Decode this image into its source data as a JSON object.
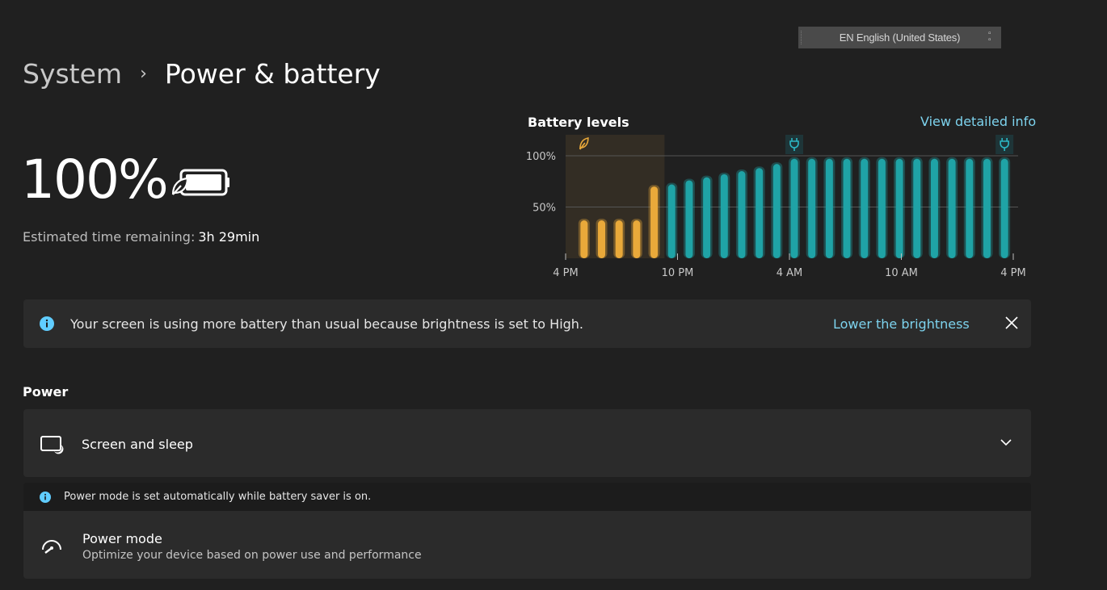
{
  "language_bar": {
    "text": "EN English (United States)"
  },
  "breadcrumb": {
    "root": "System",
    "separator": "›",
    "current": "Power & battery"
  },
  "battery": {
    "percent": "100%",
    "estimate_label": "Estimated time remaining:",
    "estimate_value": "3h 29min",
    "level": 1.0
  },
  "chart_data": {
    "type": "bar",
    "title": "Battery levels",
    "link": "View detailed info",
    "x_tick_labels": [
      "4 PM",
      "10 PM",
      "4 AM",
      "10 AM",
      "4 PM"
    ],
    "y_tick_labels": [
      "100%",
      "50%"
    ],
    "ylim": [
      0,
      100
    ],
    "grid": true,
    "series": [
      {
        "color": "#e9a93a",
        "values": [
          37,
          37,
          37,
          37,
          70
        ]
      },
      {
        "color": "#1fa3a6",
        "values": [
          72,
          76,
          79,
          82,
          85,
          88,
          92,
          97,
          97,
          97,
          97,
          97,
          97,
          97,
          97,
          97,
          97,
          97,
          97,
          97
        ]
      }
    ],
    "markers": [
      {
        "icon": "leaf-icon",
        "color": "#e9a93a"
      },
      {
        "icon": "plug-icon",
        "color": "#2bb7c4"
      },
      {
        "icon": "plug-icon",
        "color": "#2bb7c4"
      }
    ]
  },
  "banner": {
    "message": "Your screen is using more battery than usual because brightness is set to High.",
    "action": "Lower the brightness"
  },
  "power_section": {
    "label": "Power",
    "screen_sleep": {
      "label": "Screen and sleep"
    },
    "note": "Power mode is set automatically while battery saver is on.",
    "power_mode": {
      "title": "Power mode",
      "subtitle": "Optimize your device based on power use and performance"
    }
  },
  "colors": {
    "accent": "#7dd3ee",
    "saver": "#e9a93a",
    "charging": "#1fa3a6",
    "info": "#60cdff"
  }
}
